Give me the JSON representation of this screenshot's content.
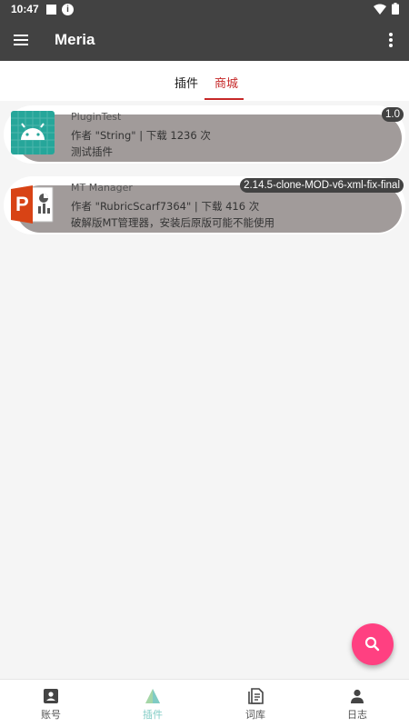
{
  "status_bar": {
    "time": "10:47",
    "icons": [
      "notification-square-icon",
      "info-icon",
      "wifi-icon",
      "battery-icon"
    ]
  },
  "app_bar": {
    "title": "Meria",
    "icons": [
      "hamburger-menu-icon",
      "overflow-menu-icon"
    ]
  },
  "tabs": [
    {
      "label": "插件",
      "active": false
    },
    {
      "label": "商城",
      "active": true
    }
  ],
  "plugins": [
    {
      "name": "PluginTest",
      "meta": "作者 \"String\" | 下载 1236 次",
      "description": "测试插件",
      "version": "1.0",
      "icon": "android-icon"
    },
    {
      "name": "MT Manager",
      "meta": "作者 \"RubricScarf7364\" | 下载 416 次",
      "description": "破解版MT管理器，安装后原版可能不能使用",
      "version": "2.14.5-clone-MOD-v6-xml-fix-final",
      "icon": "powerpoint-icon"
    }
  ],
  "fab": {
    "icon": "search-icon"
  },
  "bottom_nav": [
    {
      "label": "账号",
      "icon": "account-card-icon",
      "active": false
    },
    {
      "label": "插件",
      "icon": "plugin-triangle-icon",
      "active": true
    },
    {
      "label": "词库",
      "icon": "document-icon",
      "active": false
    },
    {
      "label": "日志",
      "icon": "person-icon",
      "active": false
    }
  ],
  "colors": {
    "bar": "#424242",
    "accent_tab": "#c62828",
    "fab": "#ff4081",
    "active_nav": "#80cbc4",
    "card_inner": "#a19b9a"
  }
}
